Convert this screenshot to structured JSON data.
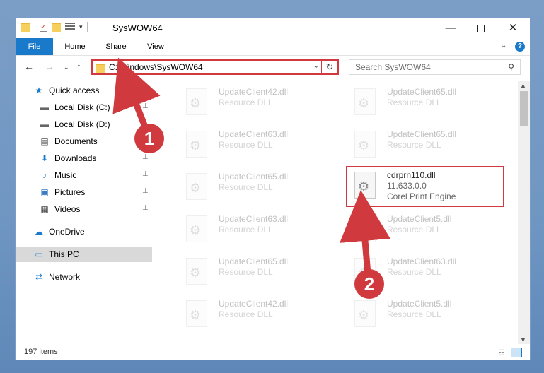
{
  "window": {
    "title": "SysWOW64",
    "minimize": "—",
    "maximize": "",
    "close": "✕"
  },
  "ribbon": {
    "tabs": [
      "File",
      "Home",
      "Share",
      "View"
    ],
    "help": "?",
    "collapse": "⌄"
  },
  "nav": {
    "back": "←",
    "forward": "→",
    "recent": "⌄",
    "up": "↑",
    "address": "C:\\Windows\\SysWOW64",
    "address_dropdown": "⌄",
    "refresh": "↻",
    "search_placeholder": "Search SysWOW64",
    "search_icon": "⚲"
  },
  "sidebar": {
    "items": [
      {
        "label": "Quick access",
        "icon": "star-icon",
        "glyph": "★",
        "color": "#1979ca"
      },
      {
        "label": "Local Disk (C:)",
        "icon": "drive-icon",
        "glyph": "▬",
        "color": "#666666",
        "pinned": true
      },
      {
        "label": "Local Disk (D:)",
        "icon": "drive-icon",
        "glyph": "▬",
        "color": "#666666"
      },
      {
        "label": "Documents",
        "icon": "document-icon",
        "glyph": "▤",
        "color": "#555555"
      },
      {
        "label": "Downloads",
        "icon": "download-icon",
        "glyph": "⬇",
        "color": "#1979ca",
        "pinned": true
      },
      {
        "label": "Music",
        "icon": "music-icon",
        "glyph": "♪",
        "color": "#1979ca",
        "pinned": true
      },
      {
        "label": "Pictures",
        "icon": "pictures-icon",
        "glyph": "▣",
        "color": "#3b7bbf",
        "pinned": true
      },
      {
        "label": "Videos",
        "icon": "videos-icon",
        "glyph": "▦",
        "color": "#444444",
        "pinned": true
      },
      {
        "label": "OneDrive",
        "icon": "cloud-icon",
        "glyph": "☁",
        "color": "#1979ca"
      },
      {
        "label": "This PC",
        "icon": "computer-icon",
        "glyph": "▭",
        "color": "#1979ca",
        "selected": true
      },
      {
        "label": "Network",
        "icon": "network-icon",
        "glyph": "⇄",
        "color": "#1979ca"
      }
    ],
    "pin_glyph": "📌"
  },
  "files": {
    "items": [
      {
        "name": "UpdateClient42.dll",
        "desc": "Resource DLL"
      },
      {
        "name": "UpdateClient65.dll",
        "desc": "Resource DLL"
      },
      {
        "name": "UpdateClient63.dll",
        "desc": "Resource DLL"
      },
      {
        "name": "UpdateClient65.dll",
        "desc": "Resource DLL"
      },
      {
        "name": "UpdateClient65.dll",
        "desc": "Resource DLL"
      },
      {
        "name": "UpdateClient63.dll",
        "desc": "Resource DLL"
      },
      {
        "name": "UpdateClient5.dll",
        "desc": "Resource DLL"
      },
      {
        "name": "UpdateClient65.dll",
        "desc": "Resource DLL"
      },
      {
        "name": "UpdateClient63.dll",
        "desc": "Resource DLL"
      },
      {
        "name": "UpdateClient42.dll",
        "desc": "Resource DLL"
      },
      {
        "name": "UpdateClient5.dll",
        "desc": "Resource DLL"
      }
    ],
    "highlighted": {
      "name": "cdrprn110.dll",
      "version": "11.633.0.0",
      "desc": "Corel Print Engine"
    }
  },
  "annotations": {
    "marker1": "1",
    "marker2": "2",
    "color": "#d0393d"
  },
  "status": {
    "count": "197 items"
  }
}
